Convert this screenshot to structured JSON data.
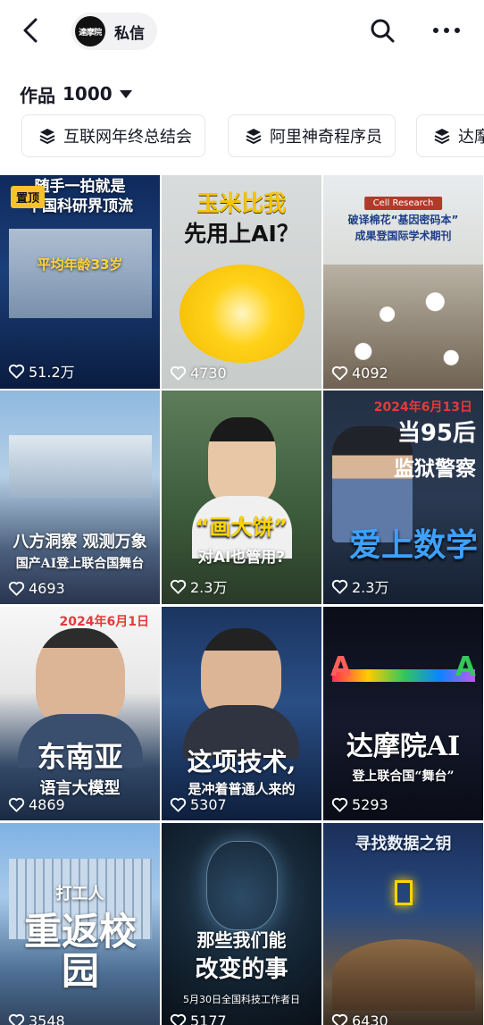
{
  "header": {
    "back_icon": "chevron-left-icon",
    "account_logo_text": "達摩院",
    "message_label": "私信",
    "search_icon": "search-icon",
    "more_icon": "more-horizontal-icon"
  },
  "works": {
    "label": "作品",
    "count": "1000"
  },
  "collections": [
    {
      "label": "互联网年终总结会",
      "icon": "layers-icon"
    },
    {
      "label": "阿里神奇程序员",
      "icon": "layers-icon"
    },
    {
      "label": "达摩",
      "icon": "layers-icon"
    }
  ],
  "videos": [
    {
      "likes": "51.2万",
      "pinned": "置顶",
      "line1": "随手一拍就是",
      "line2": "中国科研界顶流",
      "badge": "平均年龄33岁"
    },
    {
      "likes": "4730",
      "line1": "玉米比我",
      "line2": "先用上AI？"
    },
    {
      "likes": "4092",
      "tag": "Cell Research",
      "line1": "破译棉花“基因密码本”",
      "line2": "成果登国际学术期刊"
    },
    {
      "likes": "4693",
      "line1": "八方洞察 观测万象",
      "line2": "国产AI登上联合国舞台"
    },
    {
      "likes": "2.3万",
      "line1": "“画大饼”",
      "line2": "对AI也管用?"
    },
    {
      "likes": "2.3万",
      "date": "2024年6月13日",
      "line1": "当95后",
      "line2": "监狱警察",
      "line3": "爱上数学"
    },
    {
      "likes": "4869",
      "date": "2024年6月1日",
      "line1": "东南亚",
      "line2": "语言大模型"
    },
    {
      "likes": "5307",
      "line1": "这项技术,",
      "line2": "是冲着普通人来的"
    },
    {
      "likes": "5293",
      "line1": "达摩院AI",
      "line2": "登上联合国“舞台”"
    },
    {
      "likes": "3548",
      "line1": "打工人",
      "line2": "重返校园"
    },
    {
      "likes": "5177",
      "line1": "那些我们能",
      "line2": "改变的事",
      "line3": "5月30日全国科技工作者日"
    },
    {
      "likes": "6430",
      "line1": "寻找数据之钥"
    }
  ]
}
